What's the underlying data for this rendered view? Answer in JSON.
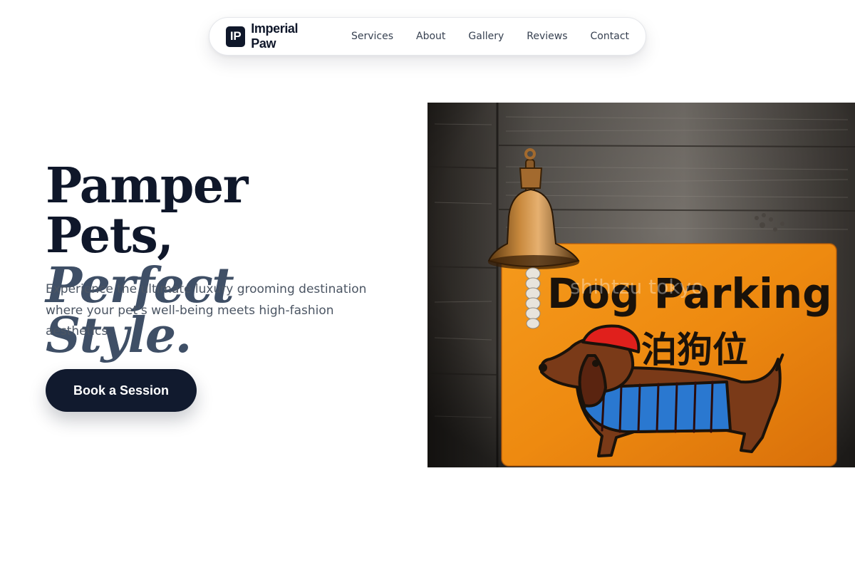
{
  "nav": {
    "brand_mark": "IP",
    "brand_name": "Imperial Paw",
    "links": [
      {
        "label": "Services"
      },
      {
        "label": "About"
      },
      {
        "label": "Gallery"
      },
      {
        "label": "Reviews"
      },
      {
        "label": "Contact"
      }
    ]
  },
  "hero": {
    "title_line1": "Pamper Pets,",
    "title_line2": "Perfect Style.",
    "subtitle": "Experience the ultimate luxury grooming destination where your pet's well-being meets high-fashion aesthetics.",
    "cta_label": "Book a Session"
  },
  "photo": {
    "sign_text": "Dog Parking",
    "sign_text_cn": "泊狗位",
    "watermark": "shihtzu tokyo"
  },
  "colors": {
    "navy": "#0f172a",
    "slate": "#3f4f66",
    "sign_orange": "#f08a12"
  }
}
